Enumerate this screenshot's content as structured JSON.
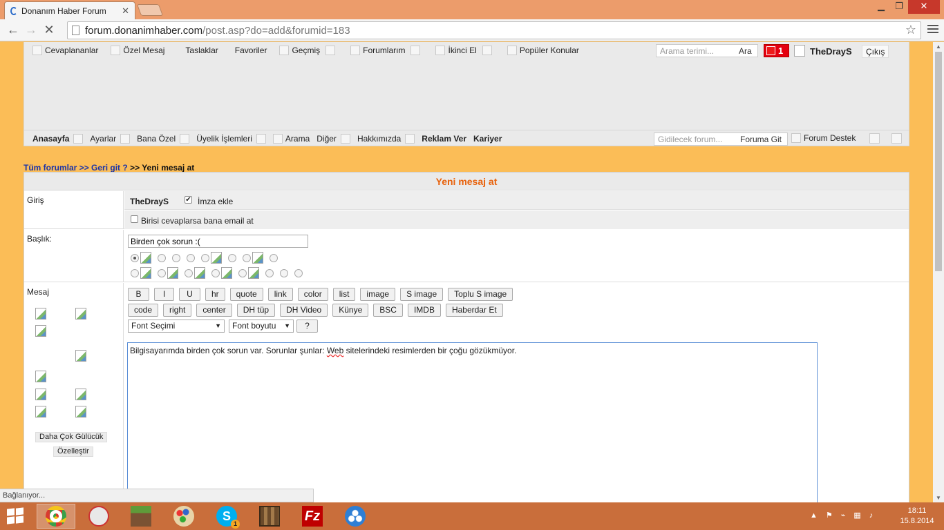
{
  "browser": {
    "tab_title": "Donanım Haber Forum",
    "tab_close": "✕",
    "url_host": "forum.donanimhaber.com",
    "url_path": "/post.asp?do=add&forumid=183",
    "back": "←",
    "forward": "→",
    "stop": "✕",
    "star": "☆",
    "win_min": "▁",
    "win_max": "❐",
    "win_close": "✕"
  },
  "topnav": {
    "items": [
      "Cevaplananlar",
      "Özel Mesaj",
      "Taslaklar",
      "Favoriler",
      "Geçmiş",
      "Forumlarım",
      "İkinci El",
      "Popüler Konular"
    ],
    "search_placeholder": "Arama terimi...",
    "search_button": "Ara",
    "notification_count": "1",
    "username": "TheDrayS",
    "logout": "Çıkış"
  },
  "mainnav": {
    "items": [
      "Anasayfa",
      "Ayarlar",
      "Bana Özel",
      "Üyelik İşlemleri",
      "Arama",
      "Diğer",
      "Hakkımızda",
      "Reklam Ver",
      "Kariyer"
    ],
    "forum_search_placeholder": "Gidilecek forum...",
    "forum_go": "Foruma Git",
    "forum_support": "Forum Destek"
  },
  "breadcrumb": {
    "all_forums": "Tüm forumlar",
    "sep": ">>",
    "back": "Geri git ?",
    "current": "Yeni mesaj at"
  },
  "form": {
    "header": "Yeni mesaj at",
    "login_label": "Giriş",
    "username": "TheDrayS",
    "signature_label": "İmza ekle",
    "signature_checked": true,
    "email_label": "Birisi cevaplarsa bana email at",
    "email_checked": false,
    "title_label": "Başlık:",
    "title_value": "Birden çok sorun :(",
    "message_label": "Mesaj",
    "editor_row1": [
      "B",
      "I",
      "U",
      "hr",
      "quote",
      "link",
      "color",
      "list",
      "image",
      "S image",
      "Toplu S image"
    ],
    "editor_row2": [
      "code",
      "right",
      "center",
      "DH tüp",
      "DH Video",
      "Künye",
      "BSC",
      "IMDB",
      "Haberdar Et"
    ],
    "font_select": "Font Seçimi",
    "size_select": "Font boyutu",
    "help_button": "?",
    "message_before": "Bilgisayarımda birden çok sorun var. Sorunlar şunlar: ",
    "message_misspelled": "Web",
    "message_after": " sitelerindeki resimlerden bir çoğu gözükmüyor.",
    "more_smileys": "Daha Çok Gülücük",
    "customize": "Özelleştir"
  },
  "status_text": "Bağlanıyor...",
  "taskbar": {
    "time": "18:11",
    "date": "15.8.2014",
    "skype_badge": "1"
  }
}
